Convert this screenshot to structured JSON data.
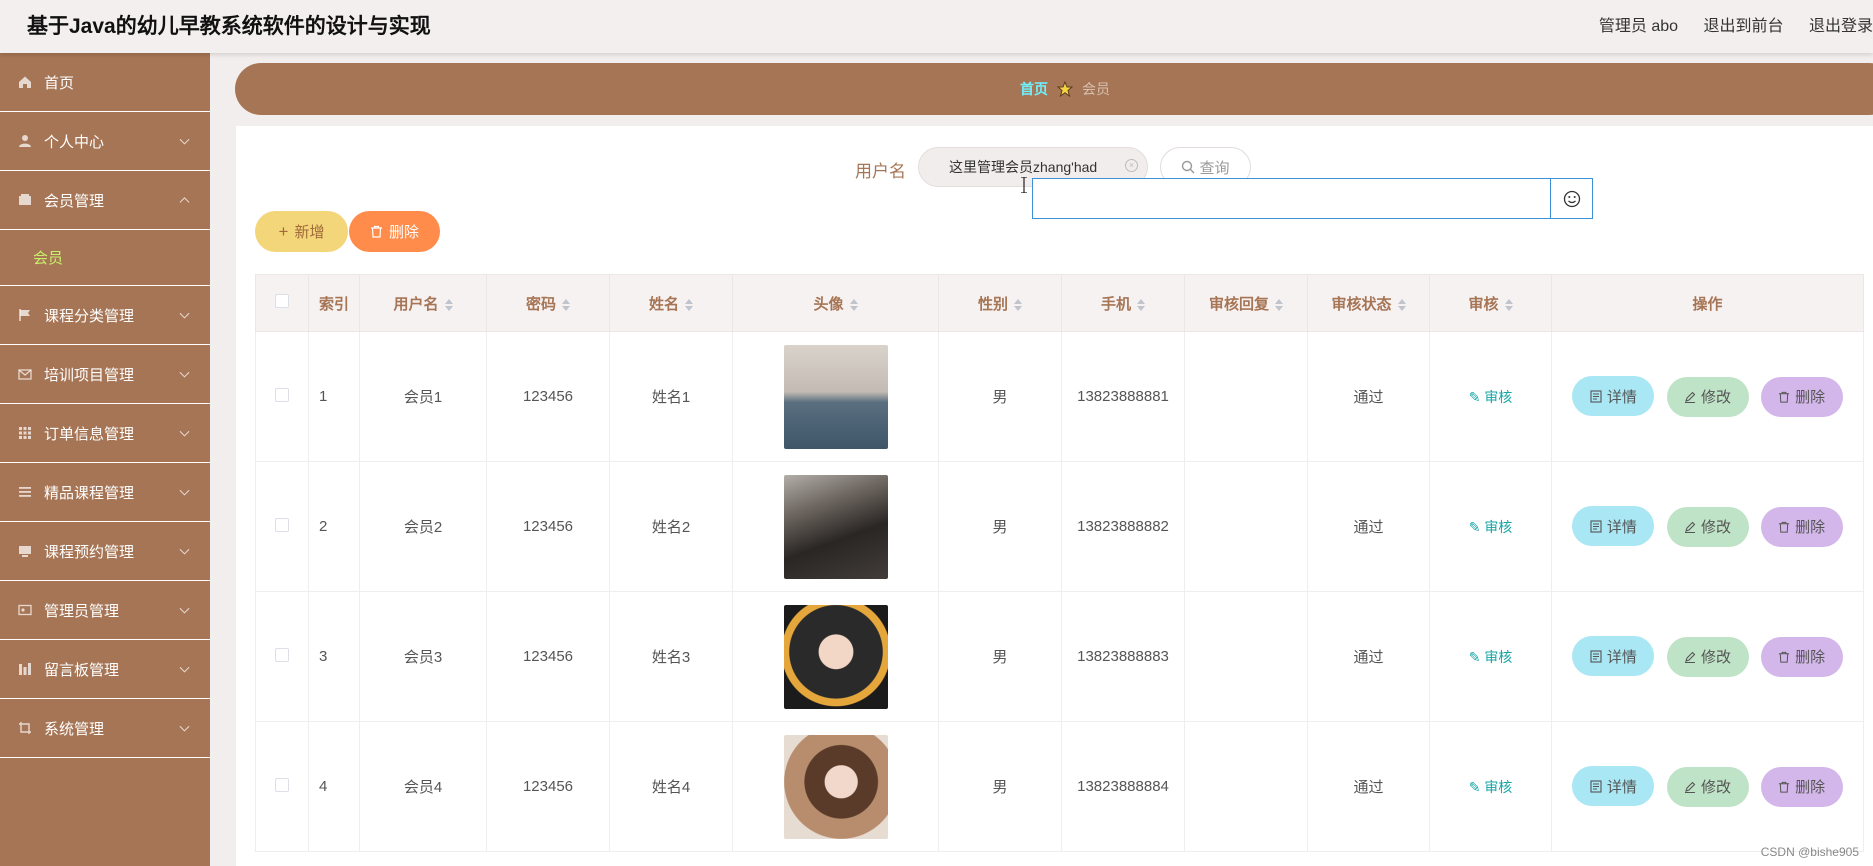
{
  "header": {
    "title": "基于Java的幼儿早教系统软件的设计与实现",
    "admin_label": "管理员 abo",
    "to_front_label": "退出到前台",
    "logout_label": "退出登录"
  },
  "sidebar": {
    "items": [
      {
        "label": "首页",
        "icon": "home-icon"
      },
      {
        "label": "个人中心",
        "icon": "user-icon"
      },
      {
        "label": "会员管理",
        "icon": "folder-icon",
        "expanded": true
      },
      {
        "label": "课程分类管理",
        "icon": "flag-icon"
      },
      {
        "label": "培训项目管理",
        "icon": "mail-icon"
      },
      {
        "label": "订单信息管理",
        "icon": "grid-icon"
      },
      {
        "label": "精品课程管理",
        "icon": "list-icon"
      },
      {
        "label": "课程预约管理",
        "icon": "box-icon"
      },
      {
        "label": "管理员管理",
        "icon": "card-icon"
      },
      {
        "label": "留言板管理",
        "icon": "chart-icon"
      },
      {
        "label": "系统管理",
        "icon": "crop-icon"
      }
    ],
    "subitem": "会员"
  },
  "breadcrumb": {
    "home": "首页",
    "current": "会员"
  },
  "search": {
    "label": "用户名",
    "value": "这里管理会员zhang'had",
    "query_label": "查询"
  },
  "toolbar": {
    "add_label": "新增",
    "delete_label": "删除"
  },
  "table": {
    "headers": [
      "索引",
      "用户名",
      "密码",
      "姓名",
      "头像",
      "性别",
      "手机",
      "审核回复",
      "审核状态",
      "审核",
      "操作"
    ],
    "audit_link": "审核",
    "actions": {
      "detail": "详情",
      "edit": "修改",
      "delete": "删除"
    },
    "rows": [
      {
        "index": "1",
        "username": "会员1",
        "password": "123456",
        "name": "姓名1",
        "gender": "男",
        "phone": "13823888881",
        "reply": "",
        "status": "通过"
      },
      {
        "index": "2",
        "username": "会员2",
        "password": "123456",
        "name": "姓名2",
        "gender": "男",
        "phone": "13823888882",
        "reply": "",
        "status": "通过"
      },
      {
        "index": "3",
        "username": "会员3",
        "password": "123456",
        "name": "姓名3",
        "gender": "男",
        "phone": "13823888883",
        "reply": "",
        "status": "通过"
      },
      {
        "index": "4",
        "username": "会员4",
        "password": "123456",
        "name": "姓名4",
        "gender": "男",
        "phone": "13823888884",
        "reply": "",
        "status": "通过"
      }
    ]
  },
  "watermark": "CSDN @bishe905",
  "colors": {
    "brand": "#a67555",
    "accent_text": "#6ff0ff",
    "submenu": "#c7f06a"
  }
}
